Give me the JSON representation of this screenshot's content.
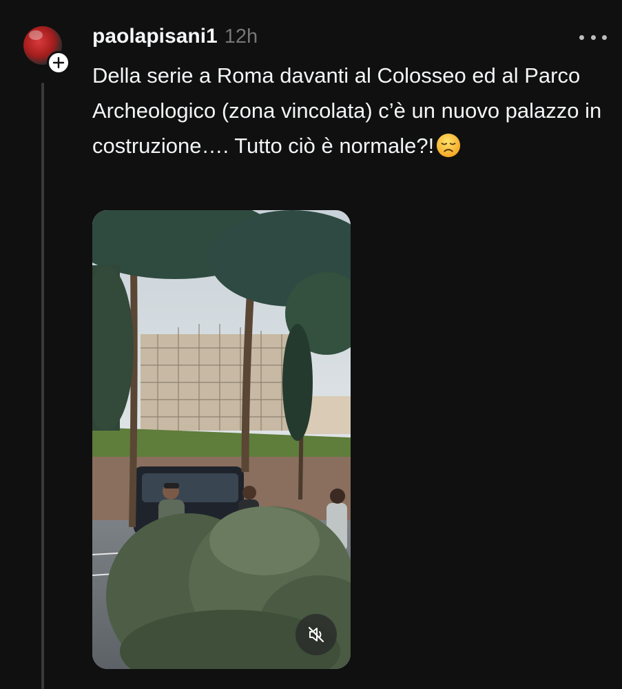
{
  "post": {
    "username": "paolapisani1",
    "timestamp": "12h",
    "text": "Della serie a Roma davanti al Colosseo ed al Parco Archeologico (zona vincolata) c’è un nuovo palazzo in costruzione…. Tutto ciò è normale?!",
    "emoji": "disappointed-face-icon"
  },
  "icons": {
    "follow": "plus-icon",
    "more": "more-options-icon",
    "mute": "speaker-muted-icon"
  },
  "media": {
    "type": "video",
    "muted": true
  }
}
